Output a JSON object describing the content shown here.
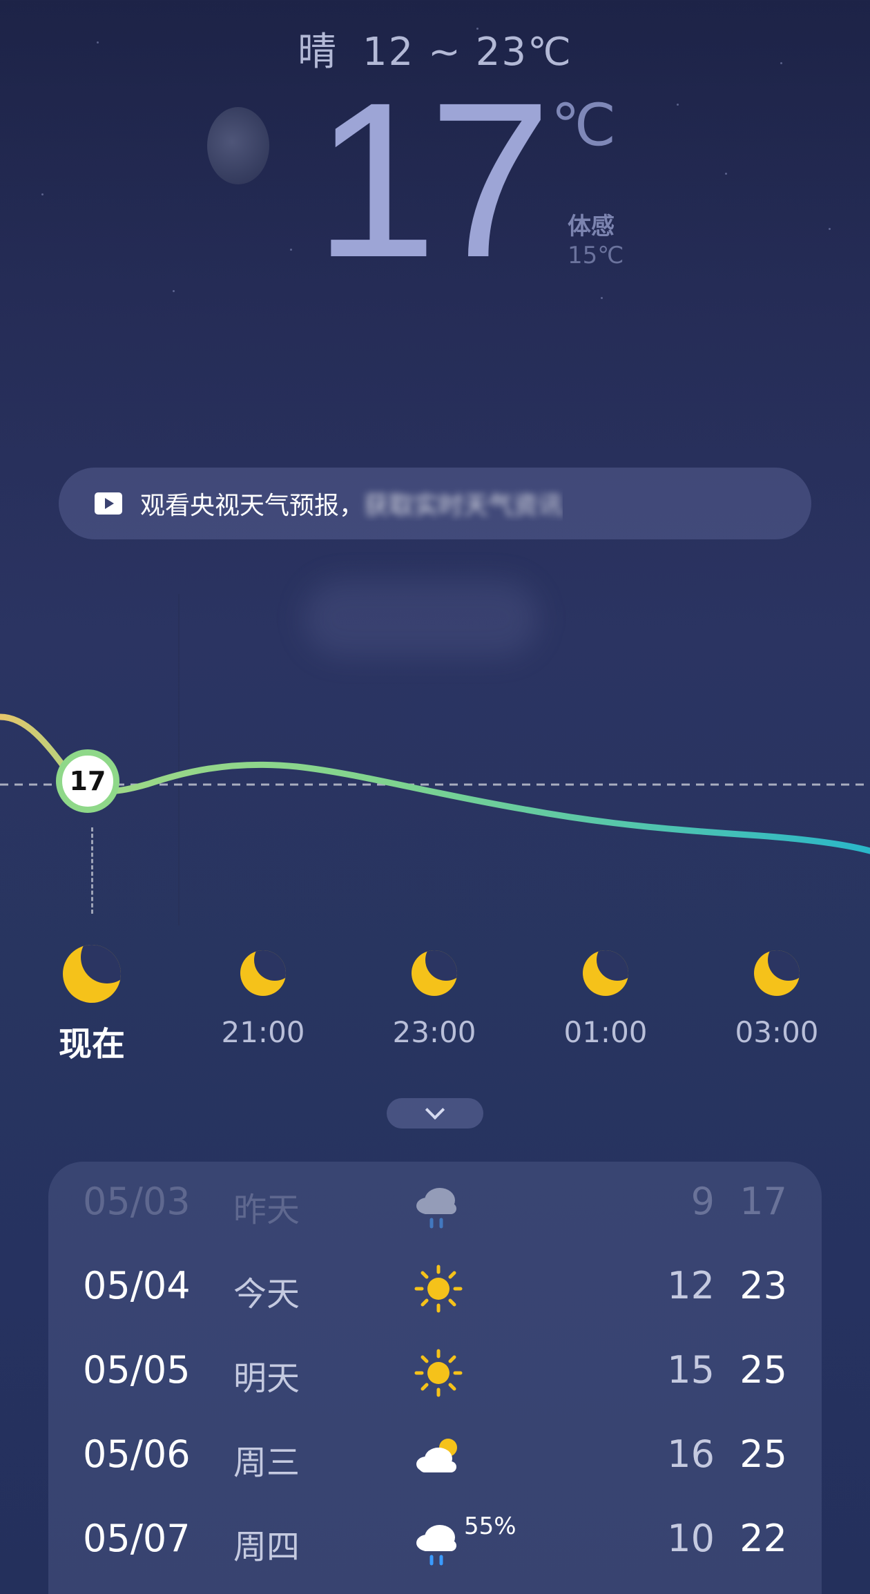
{
  "header": {
    "condition": "晴",
    "temp_range": "12 ~ 23℃",
    "current_temp": "17",
    "current_unit": "℃",
    "feels_like_label": "体感",
    "feels_like_value": "15℃"
  },
  "banner": {
    "icon": "play-icon",
    "text": "观看央视天气预报，",
    "text_obscured": "获取实时天气资讯"
  },
  "chart_data": {
    "type": "line",
    "x": [
      "现在",
      "21:00",
      "23:00",
      "01:00",
      "03:00"
    ],
    "current_value": 17,
    "colors": {
      "warm": "#e7c66b",
      "mid": "#8fd889",
      "cool": "#2ab7c9"
    }
  },
  "hourly": [
    {
      "label": "现在",
      "icon": "moon-icon",
      "is_now": true
    },
    {
      "label": "21:00",
      "icon": "moon-icon"
    },
    {
      "label": "23:00",
      "icon": "moon-icon"
    },
    {
      "label": "01:00",
      "icon": "moon-icon"
    },
    {
      "label": "03:00",
      "icon": "moon-icon"
    }
  ],
  "daily": [
    {
      "date": "05/03",
      "name": "昨天",
      "icon": "cloud-rain-icon",
      "low": "9",
      "high": "17",
      "past": true
    },
    {
      "date": "05/04",
      "name": "今天",
      "icon": "sun-icon",
      "low": "12",
      "high": "23"
    },
    {
      "date": "05/05",
      "name": "明天",
      "icon": "sun-icon",
      "low": "15",
      "high": "25"
    },
    {
      "date": "05/06",
      "name": "周三",
      "icon": "cloud-sun-icon",
      "low": "16",
      "high": "25"
    },
    {
      "date": "05/07",
      "name": "周四",
      "icon": "cloud-rain-icon",
      "precip": "55%",
      "low": "10",
      "high": "22"
    }
  ],
  "colors": {
    "moon": "#f5c21a",
    "sun": "#f5c21a",
    "text_primary": "#ffffff",
    "text_muted": "#c5cae0"
  }
}
